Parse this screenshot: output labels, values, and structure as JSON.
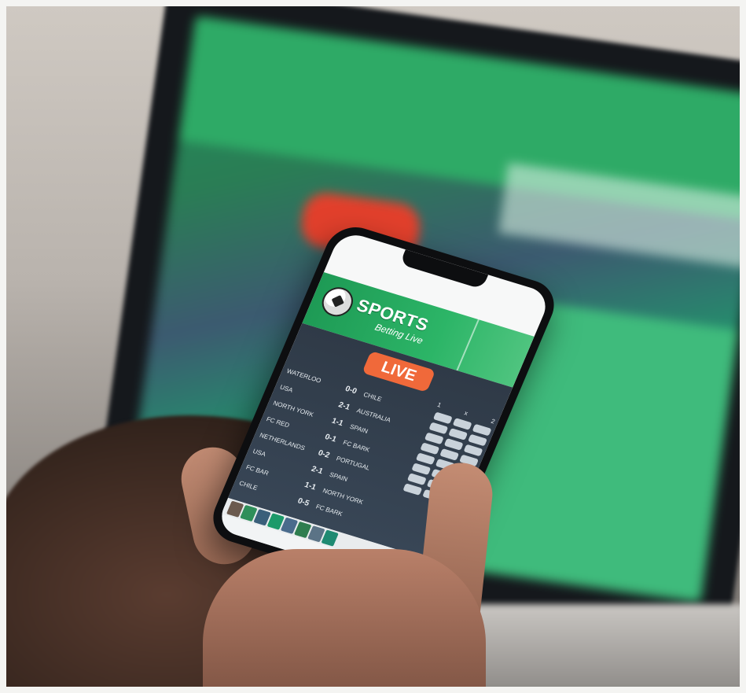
{
  "app": {
    "brand_title": "SPORTS",
    "brand_subtitle": "Betting Live",
    "live_label": "LIVE"
  },
  "odds_header": [
    "1",
    "x",
    "2"
  ],
  "matches": [
    {
      "team_a": "Waterloo",
      "score": "0-0",
      "team_b": "Chile"
    },
    {
      "team_a": "USA",
      "score": "2-1",
      "team_b": "Australia"
    },
    {
      "team_a": "North York",
      "score": "1-1",
      "team_b": "Spain"
    },
    {
      "team_a": "FC Red",
      "score": "0-1",
      "team_b": "FC Bark"
    },
    {
      "team_a": "Netherlands",
      "score": "0-2",
      "team_b": "Portugal"
    },
    {
      "team_a": "USA",
      "score": "2-1",
      "team_b": "Spain"
    },
    {
      "team_a": "FC Bar",
      "score": "1-1",
      "team_b": "North York"
    },
    {
      "team_a": "Chile",
      "score": "0-5",
      "team_b": "FC Bark"
    }
  ],
  "colors": {
    "header_green": "#2cb567",
    "live_orange": "#f0693a",
    "panel_dark": "#2f3a47"
  }
}
